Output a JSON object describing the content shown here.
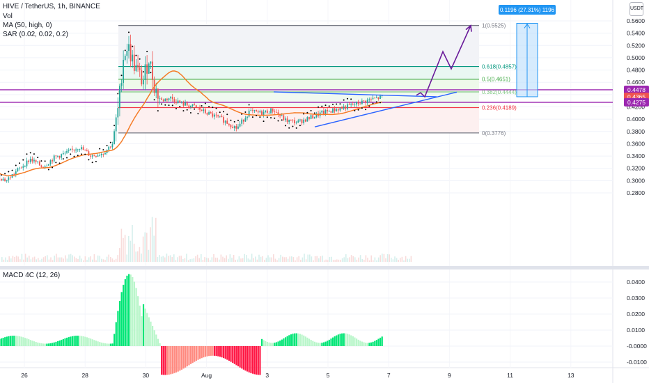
{
  "legend": {
    "symbol": "HIVE / TetherUS, 1h, BINANCE",
    "vol": "Vol",
    "ma": "MA (50, high, 0)",
    "sar": "SAR (0.02, 0.02, 0.2)",
    "macd": "MACD 4C (12, 26)"
  },
  "currency_label": "USDT",
  "measure_label": "0.1196 (27.31%) 1196",
  "colors": {
    "up": "#26a69a",
    "down": "#ef5350",
    "ma": "#f57c27",
    "sar": "#000000",
    "trendline": "#2962ff",
    "projection": "#6a1b9a",
    "level_purple": "#9c27b0",
    "macd_up_strong": "#00e676",
    "macd_up_weak": "#b9f6ca",
    "macd_down_strong": "#ff1744",
    "macd_down_weak": "#ff8a80",
    "measure": "#2196f3"
  },
  "chart_data": [
    {
      "type": "candlestick",
      "title": "HIVE / TetherUS, 1h, BINANCE",
      "ylim": [
        0.272,
        0.57
      ],
      "y_ticks": [
        0.28,
        0.3,
        0.32,
        0.34,
        0.36,
        0.38,
        0.4,
        0.42,
        0.44,
        0.46,
        0.48,
        0.5,
        0.52,
        0.54,
        0.56
      ],
      "y_tick_labels": [
        "0.2800",
        "0.3000",
        "0.3200",
        "0.3400",
        "0.3600",
        "0.3800",
        "0.4000",
        "0.4200",
        "0.4400",
        "0.4600",
        "0.4800",
        "0.5000",
        "0.5200",
        "0.5400",
        "0.5600"
      ],
      "x_ticks": [
        "26",
        "28",
        "30",
        "Aug",
        "3",
        "5",
        "7",
        "9",
        "11",
        "13"
      ],
      "x_range_days": [
        25.0,
        38.0
      ],
      "price_path": [
        [
          25.0,
          0.31
        ],
        [
          25.4,
          0.3
        ],
        [
          25.8,
          0.318
        ],
        [
          26.2,
          0.335
        ],
        [
          26.6,
          0.322
        ],
        [
          27.0,
          0.338
        ],
        [
          27.4,
          0.345
        ],
        [
          27.8,
          0.355
        ],
        [
          28.2,
          0.34
        ],
        [
          28.6,
          0.345
        ],
        [
          28.9,
          0.36
        ],
        [
          29.1,
          0.42
        ],
        [
          29.25,
          0.5
        ],
        [
          29.4,
          0.52
        ],
        [
          29.6,
          0.49
        ],
        [
          29.9,
          0.46
        ],
        [
          30.1,
          0.5
        ],
        [
          30.3,
          0.45
        ],
        [
          30.5,
          0.43
        ],
        [
          30.8,
          0.435
        ],
        [
          31.2,
          0.425
        ],
        [
          31.6,
          0.42
        ],
        [
          32.0,
          0.41
        ],
        [
          32.5,
          0.4
        ],
        [
          33.0,
          0.385
        ],
        [
          33.4,
          0.412
        ],
        [
          33.8,
          0.41
        ],
        [
          34.2,
          0.415
        ],
        [
          34.6,
          0.398
        ],
        [
          35.0,
          0.395
        ],
        [
          35.4,
          0.402
        ],
        [
          35.8,
          0.41
        ],
        [
          36.2,
          0.415
        ],
        [
          36.6,
          0.42
        ],
        [
          37.0,
          0.426
        ],
        [
          37.4,
          0.432
        ],
        [
          37.8,
          0.436
        ]
      ],
      "fibonacci_levels": [
        {
          "ratio": "1",
          "value": 0.5525,
          "label": "1(0.5525)"
        },
        {
          "ratio": "0.618",
          "value": 0.4857,
          "label": "0.618(0.4857)"
        },
        {
          "ratio": "0.5",
          "value": 0.4651,
          "label": "0.5(0.4651)"
        },
        {
          "ratio": "0.382",
          "value": 0.4444,
          "label": "0.382(0.4444)"
        },
        {
          "ratio": "0.236",
          "value": 0.4189,
          "label": "0.236(0.4189)"
        },
        {
          "ratio": "0",
          "value": 0.3776,
          "label": "0(0.3776)"
        }
      ],
      "horizontal_levels": [
        0.4478,
        0.4275
      ],
      "price_labels": [
        {
          "value": 0.4478,
          "label": "0.4478"
        },
        {
          "value": 0.4365,
          "label": "0.4365"
        },
        {
          "value": 0.4275,
          "label": "0.4275"
        }
      ],
      "measure": {
        "from": 0.4365,
        "to": 0.5561,
        "label": "0.1196 (27.31%) 1196"
      },
      "grid": true
    },
    {
      "type": "bar",
      "title": "MACD 4C (12, 26)",
      "ylim": [
        -0.0035,
        0.0055
      ],
      "y_ticks": [
        0.004,
        0.003,
        0.002,
        0.001,
        0.0,
        -0.001
      ],
      "y_tick_labels": [
        "0.0400",
        "0.0300",
        "0.0200",
        "0.0100",
        "-0.0000",
        "-0.0100"
      ]
    }
  ]
}
